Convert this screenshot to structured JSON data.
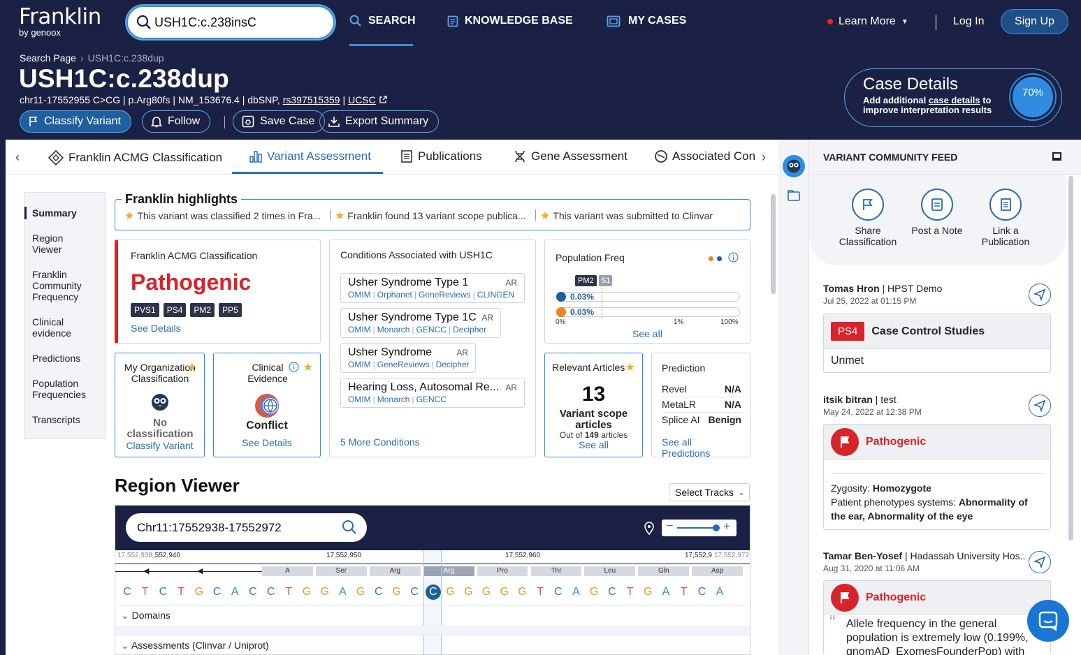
{
  "nav": {
    "logo": "Franklin",
    "logo_sub": "by genoox",
    "search_value": "USH1C:c.238insC",
    "items": {
      "search": "SEARCH",
      "kb": "KNOWLEDGE BASE",
      "cases": "MY CASES"
    },
    "learn_more": "Learn More",
    "login": "Log In",
    "signup": "Sign Up"
  },
  "header": {
    "breadcrumb_root": "Search Page",
    "breadcrumb_current": "USH1C:c.238dup",
    "title": "USH1C:c.238dup",
    "sub_plain": "chr11-17552955 C>CG | p.Arg80fs | NM_153676.4 | dbSNP,",
    "sub_rs": "rs397515359",
    "sub_pipe": "|",
    "sub_ucsc": "UCSC",
    "buttons": {
      "classify": "Classify Variant",
      "follow": "Follow",
      "save": "Save Case",
      "export": "Export Summary"
    }
  },
  "case_details": {
    "title": "Case Details",
    "desc_a": "Add additional ",
    "desc_link": "case details",
    "desc_b": " to improve interpretation results",
    "percent": "70%",
    "percent_value": 0.7
  },
  "tabs": [
    "Franklin ACMG Classification",
    "Variant Assessment",
    "Publications",
    "Gene Assessment",
    "Associated Conditions"
  ],
  "left_nav": [
    "Summary",
    "Region Viewer",
    "Franklin Community Frequency",
    "Clinical evidence",
    "Predictions",
    "Population Frequencies",
    "Transcripts"
  ],
  "highlights": {
    "title": "Franklin highlights",
    "items": [
      "This variant was classified 2 times in Fra...",
      "Franklin found 13 variant scope publica...",
      "This variant was submitted to Clinvar"
    ]
  },
  "acmg": {
    "title": "Franklin ACMG Classification",
    "verdict": "Pathogenic",
    "tags": [
      "PVS1",
      "PS4",
      "PM2",
      "PP5"
    ],
    "see_details": "See Details"
  },
  "my_org": {
    "title": "My Organization Classification",
    "status": "No classification",
    "action": "Classify Variant"
  },
  "clinical": {
    "title": "Clinical Evidence",
    "status": "Conflict",
    "action": "See Details"
  },
  "conditions": {
    "title": "Conditions Associated with USH1C",
    "items": [
      {
        "name": "Usher Syndrome Type 1",
        "inh": "AR",
        "links": [
          "OMIM",
          "Orphanet",
          "GeneReviews",
          "CLINGEN"
        ]
      },
      {
        "name": "Usher Syndrome Type 1C",
        "inh": "AR",
        "links": [
          "OMIM",
          "Monarch",
          "GENCC",
          "Decipher"
        ]
      },
      {
        "name": "Usher Syndrome",
        "inh": "AR",
        "links": [
          "OMIM",
          "GeneReviews",
          "Decipher"
        ]
      },
      {
        "name": "Hearing Loss, Autosomal Re...",
        "inh": "AR",
        "links": [
          "OMIM",
          "Monarch",
          "GENCC"
        ]
      }
    ],
    "more": "5 More Conditions"
  },
  "pop_freq": {
    "title": "Population Freq",
    "badges": [
      "PM2",
      "S1"
    ],
    "rows": [
      {
        "label": "0.03%",
        "color": "#1f5f9e"
      },
      {
        "label": "0.03%",
        "color": "#f0831b"
      }
    ],
    "scale": [
      "0%",
      "1%",
      "100%"
    ],
    "see_all": "See all"
  },
  "articles": {
    "title": "Relevant Articles",
    "count": "13",
    "label": "Variant scope articles",
    "out_of_a": "Out of ",
    "out_of_n": "149",
    "out_of_b": " articles",
    "see_all": "See all"
  },
  "prediction": {
    "title": "Prediction",
    "rows": [
      {
        "k": "Revel",
        "v": "N/A"
      },
      {
        "k": "MetaLR",
        "v": "N/A"
      },
      {
        "k": "Splice AI",
        "v": "Benign"
      }
    ],
    "see_all": "See all Predictions"
  },
  "region_viewer": {
    "title": "Region Viewer",
    "select_tracks": "Select Tracks",
    "location": "Chr11:17552938-17552972",
    "ruler": [
      "17,552,938",
      ",552,940",
      "17,552,950",
      "17,552,960",
      "17,552,9",
      "17,552,972"
    ],
    "amino_acids": [
      "A",
      "Ser",
      "Arg",
      "Arg",
      "Pro",
      "Thr",
      "Leu",
      "Gln",
      "Asp"
    ],
    "sequence": [
      "C",
      "T",
      "C",
      "T",
      "G",
      "C",
      "A",
      "C",
      "C",
      "T",
      "G",
      "G",
      "A",
      "G",
      "C",
      "G",
      "C",
      "C",
      "G",
      "G",
      "G",
      "G",
      "G",
      "T",
      "C",
      "A",
      "G",
      "C",
      "T",
      "G",
      "A",
      "T",
      "C",
      "A"
    ],
    "sections": [
      "Domains",
      "Assessments (Clinvar / Uniprot)"
    ]
  },
  "feed": {
    "title": "VARIANT COMMUNITY FEED",
    "actions": [
      "Share Classification",
      "Post a Note",
      "Link a Publication"
    ],
    "posts": [
      {
        "author": "Tomas Hron",
        "org": " | HPST Demo",
        "date": "Jul 25, 2022 at 01:15 PM",
        "tag": "PS4",
        "heading": "Case Control Studies",
        "body": "Unmet"
      },
      {
        "author": "itsik bitran",
        "org": " | test",
        "date": "May 24, 2022 at 12:38 PM",
        "heading": "Pathogenic",
        "zyg_label": "Zygosity: ",
        "zyg": "Homozygote",
        "ph_label": "Patient phenotypes systems: ",
        "ph": "Abnormality of the ear, Abnormality of the eye"
      },
      {
        "author": "Tamar Ben-Yosef",
        "org": " | Hadassah University Hos...",
        "date": "Aug 31, 2020 at 11:06 AM",
        "heading": "Pathogenic",
        "quote": "Allele frequency in the general population is extremely low (0.199%, gnomAD_ExomesFounderPop) with"
      }
    ]
  },
  "colors": {
    "navy": "#1b2145",
    "accent": "#2b6cb0",
    "pathogenic": "#d8232a"
  }
}
